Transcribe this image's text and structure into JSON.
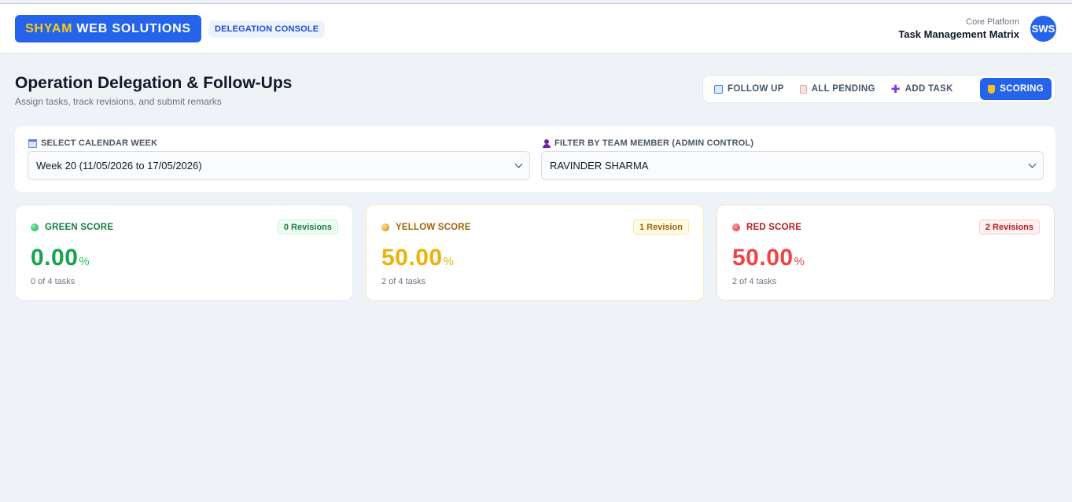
{
  "header": {
    "logo_part1": "SHYAM",
    "logo_part2": "WEB SOLUTIONS",
    "console_badge": "DELEGATION CONSOLE",
    "platform_label": "Core Platform",
    "platform_title": "Task Management Matrix",
    "avatar": "SWS"
  },
  "page": {
    "title": "Operation Delegation & Follow-Ups",
    "subtitle": "Assign tasks, track revisions, and submit remarks"
  },
  "tabs": [
    {
      "label": "FOLLOW UP",
      "icon": "refresh-icon",
      "active": false
    },
    {
      "label": "ALL PENDING",
      "icon": "clipboard-icon",
      "active": false
    },
    {
      "label": "ADD TASK",
      "icon": "plus-icon",
      "active": false
    },
    {
      "label": "SCORING",
      "icon": "trophy-icon",
      "active": true
    }
  ],
  "filters": {
    "week_label": "SELECT CALENDAR WEEK",
    "week_value": "Week 20 (11/05/2026 to 17/05/2026)",
    "member_label": "FILTER BY TEAM MEMBER (ADMIN CONTROL)",
    "member_value": "RAVINDER SHARMA"
  },
  "scores": [
    {
      "title": "GREEN SCORE",
      "badge": "0 Revisions",
      "value": "0.00",
      "unit": "%",
      "sub": "0 of 4 tasks",
      "color": "#16a34a"
    },
    {
      "title": "YELLOW SCORE",
      "badge": "1 Revision",
      "value": "50.00",
      "unit": "%",
      "sub": "2 of 4 tasks",
      "color": "#eab308"
    },
    {
      "title": "RED SCORE",
      "badge": "2 Revisions",
      "value": "50.00",
      "unit": "%",
      "sub": "2 of 4 tasks",
      "color": "#ef4444"
    }
  ],
  "colors": {
    "brand": "#2563eb",
    "logo_accent": "#facc15",
    "background": "#eff2f6"
  }
}
